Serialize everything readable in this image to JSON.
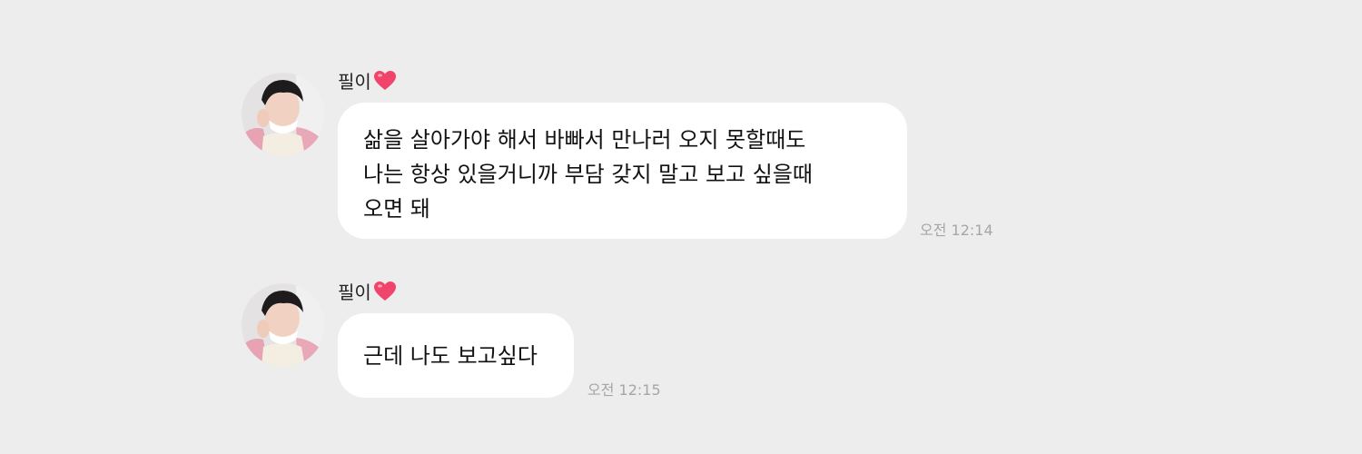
{
  "messages": [
    {
      "sender": "필이",
      "sender_emoji": "heart-emoji",
      "lines": [
        "삶을 살아가야 해서 바빠서 만나러 오지 못할때도",
        "나는 항상 있을거니까 부담 갖지 말고 보고 싶을때",
        "오면 돼"
      ],
      "time": "오전 12:14"
    },
    {
      "sender": "필이",
      "sender_emoji": "heart-emoji",
      "lines": [
        "근데 나도 보고싶다"
      ],
      "time": "오전 12:15"
    }
  ],
  "colors": {
    "background": "#ededed",
    "bubble": "#ffffff",
    "time_text": "#a6a6a6",
    "heart": "#f0446a"
  }
}
